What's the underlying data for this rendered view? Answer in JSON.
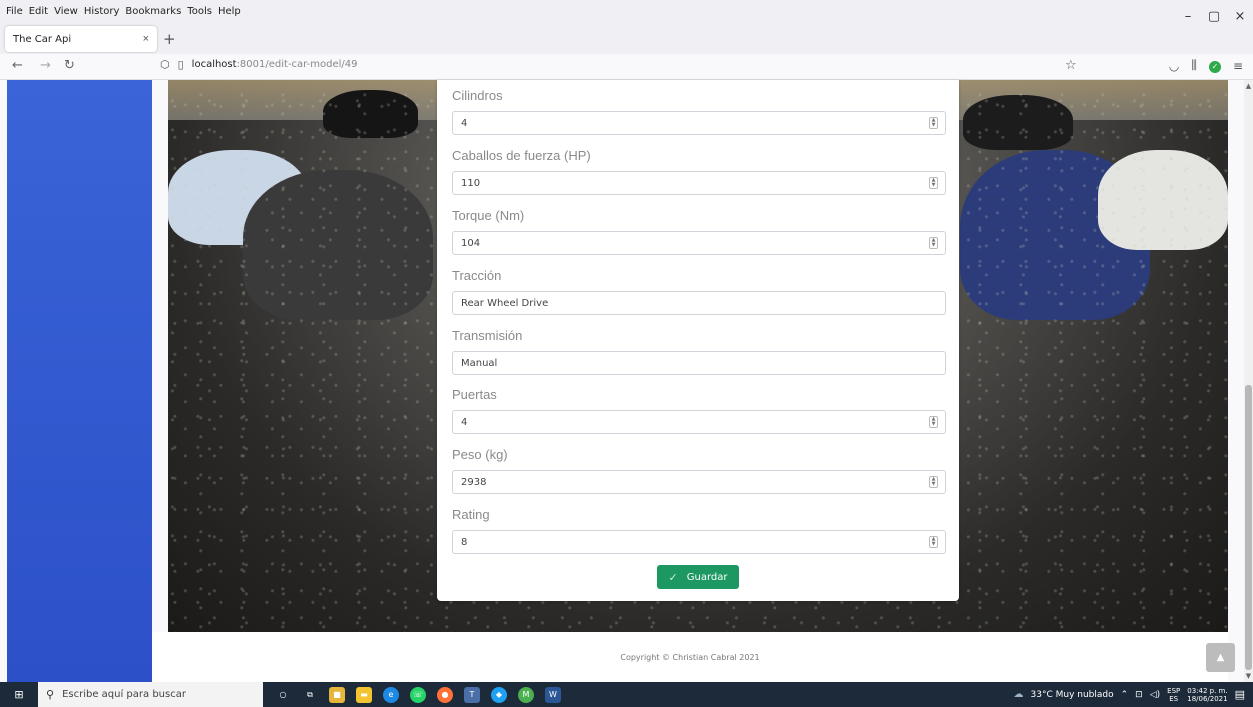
{
  "browser": {
    "menu": [
      "File",
      "Edit",
      "View",
      "History",
      "Bookmarks",
      "Tools",
      "Help"
    ],
    "tab_title": "The Car Api",
    "tab_close": "×",
    "new_tab": "+",
    "url_host": "localhost",
    "url_path": ":8001/edit-car-model/49",
    "window_controls": [
      "–",
      "▢",
      "×"
    ]
  },
  "form": {
    "fields": [
      {
        "label": "Cilindros",
        "value": "4",
        "type": "number"
      },
      {
        "label": "Caballos de fuerza (HP)",
        "value": "110",
        "type": "number"
      },
      {
        "label": "Torque (Nm)",
        "value": "104",
        "type": "number"
      },
      {
        "label": "Tracción",
        "value": "Rear Wheel Drive",
        "type": "text"
      },
      {
        "label": "Transmisión",
        "value": "Manual",
        "type": "text"
      },
      {
        "label": "Puertas",
        "value": "4",
        "type": "number"
      },
      {
        "label": "Peso (kg)",
        "value": "2938",
        "type": "number"
      },
      {
        "label": "Rating",
        "value": "8",
        "type": "number"
      }
    ],
    "save_label": "Guardar"
  },
  "footer": {
    "copyright": "Copyright © Christian Cabral 2021"
  },
  "taskbar": {
    "search_placeholder": "Escribe aquí para buscar",
    "weather": "33°C  Muy nublado",
    "lang_top": "ESP",
    "lang_bottom": "ES",
    "time": "03:42 p. m.",
    "date": "18/06/2021"
  },
  "colors": {
    "sidebar": "#2c50c8",
    "save_button": "#1d9862",
    "taskbar": "#1c2a3a"
  }
}
